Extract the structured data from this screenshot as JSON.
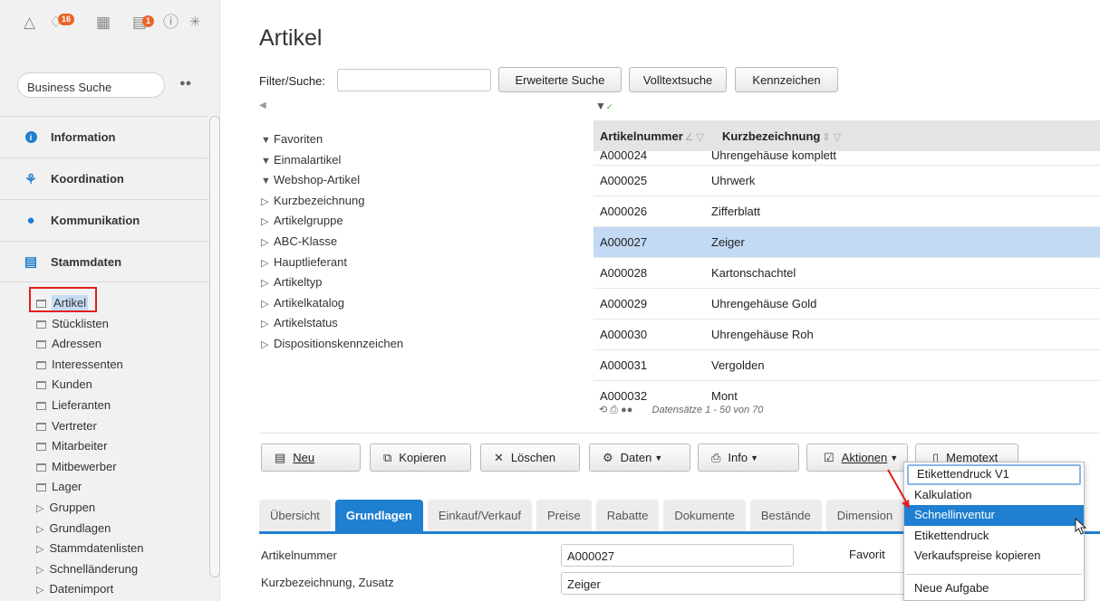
{
  "sidebar": {
    "badges": {
      "b1": "16",
      "b2": "1"
    },
    "search_placeholder": "Business Suche",
    "sections": [
      {
        "label": "Information"
      },
      {
        "label": "Koordination"
      },
      {
        "label": "Kommunikation"
      },
      {
        "label": "Stammdaten"
      }
    ],
    "items": [
      {
        "label": "Artikel"
      },
      {
        "label": "Stücklisten"
      },
      {
        "label": "Adressen"
      },
      {
        "label": "Interessenten"
      },
      {
        "label": "Kunden"
      },
      {
        "label": "Lieferanten"
      },
      {
        "label": "Vertreter"
      },
      {
        "label": "Mitarbeiter"
      },
      {
        "label": "Mitbewerber"
      },
      {
        "label": "Lager"
      },
      {
        "label": "Gruppen"
      },
      {
        "label": "Grundlagen"
      },
      {
        "label": "Stammdatenlisten"
      },
      {
        "label": "Schnelländerung"
      },
      {
        "label": "Datenimport"
      }
    ]
  },
  "main": {
    "title": "Artikel",
    "filter_label": "Filter/Suche:",
    "buttons": {
      "erweiterte_suche": "Erweiterte Suche",
      "volltextsuche": "Volltextsuche",
      "kennzeichen": "Kennzeichen"
    },
    "tree": [
      {
        "label": "Favoriten"
      },
      {
        "label": "Einmalartikel"
      },
      {
        "label": "Webshop-Artikel"
      },
      {
        "label": "Kurzbezeichnung"
      },
      {
        "label": "Artikelgruppe"
      },
      {
        "label": "ABC-Klasse"
      },
      {
        "label": "Hauptlieferant"
      },
      {
        "label": "Artikeltyp"
      },
      {
        "label": "Artikelkatalog"
      },
      {
        "label": "Artikelstatus"
      },
      {
        "label": "Dispositionskennzeichen"
      }
    ],
    "table": {
      "columns": [
        "Artikelnummer",
        "Kurzbezeichnung"
      ],
      "rows": [
        [
          "A000024",
          "Uhrengehäuse komplett"
        ],
        [
          "A000025",
          "Uhrwerk"
        ],
        [
          "A000026",
          "Zifferblatt"
        ],
        [
          "A000027",
          "Zeiger"
        ],
        [
          "A000028",
          "Kartonschachtel"
        ],
        [
          "A000029",
          "Uhrengehäuse Gold"
        ],
        [
          "A000030",
          "Uhrengehäuse Roh"
        ],
        [
          "A000031",
          "Vergolden"
        ],
        [
          "A000032",
          "Mont"
        ]
      ],
      "records": "Datensätze 1 - 50 von 70"
    },
    "toolbar": {
      "neu": "Neu",
      "kopieren": "Kopieren",
      "loeschen": "Löschen",
      "daten": "Daten",
      "info": "Info",
      "aktionen": "Aktionen",
      "memotext": "Memotext"
    },
    "tabs": [
      {
        "label": "Übersicht"
      },
      {
        "label": "Grundlagen"
      },
      {
        "label": "Einkauf/Verkauf"
      },
      {
        "label": "Preise"
      },
      {
        "label": "Rabatte"
      },
      {
        "label": "Dokumente"
      },
      {
        "label": "Bestände"
      },
      {
        "label": "Dimension"
      }
    ],
    "form": {
      "artikelnummer_label": "Artikelnummer",
      "artikelnummer_value": "A000027",
      "kurzbez_label": "Kurzbezeichnung, Zusatz",
      "kurzbez_value": "Zeiger",
      "favorit_label": "Favorit"
    },
    "menu": {
      "items": [
        {
          "label": "Etikettendruck V1"
        },
        {
          "label": "Kalkulation"
        },
        {
          "label": "Schnellinventur"
        },
        {
          "label": "Etikettendruck"
        },
        {
          "label": "Verkaufspreise kopieren"
        },
        {
          "label": "Neue Aufgabe"
        }
      ]
    }
  },
  "colors": {
    "accent": "#1f7fd0",
    "selection": "#c3daf5",
    "highlight_box": "#e21d1d",
    "badge": "#e8642a"
  }
}
